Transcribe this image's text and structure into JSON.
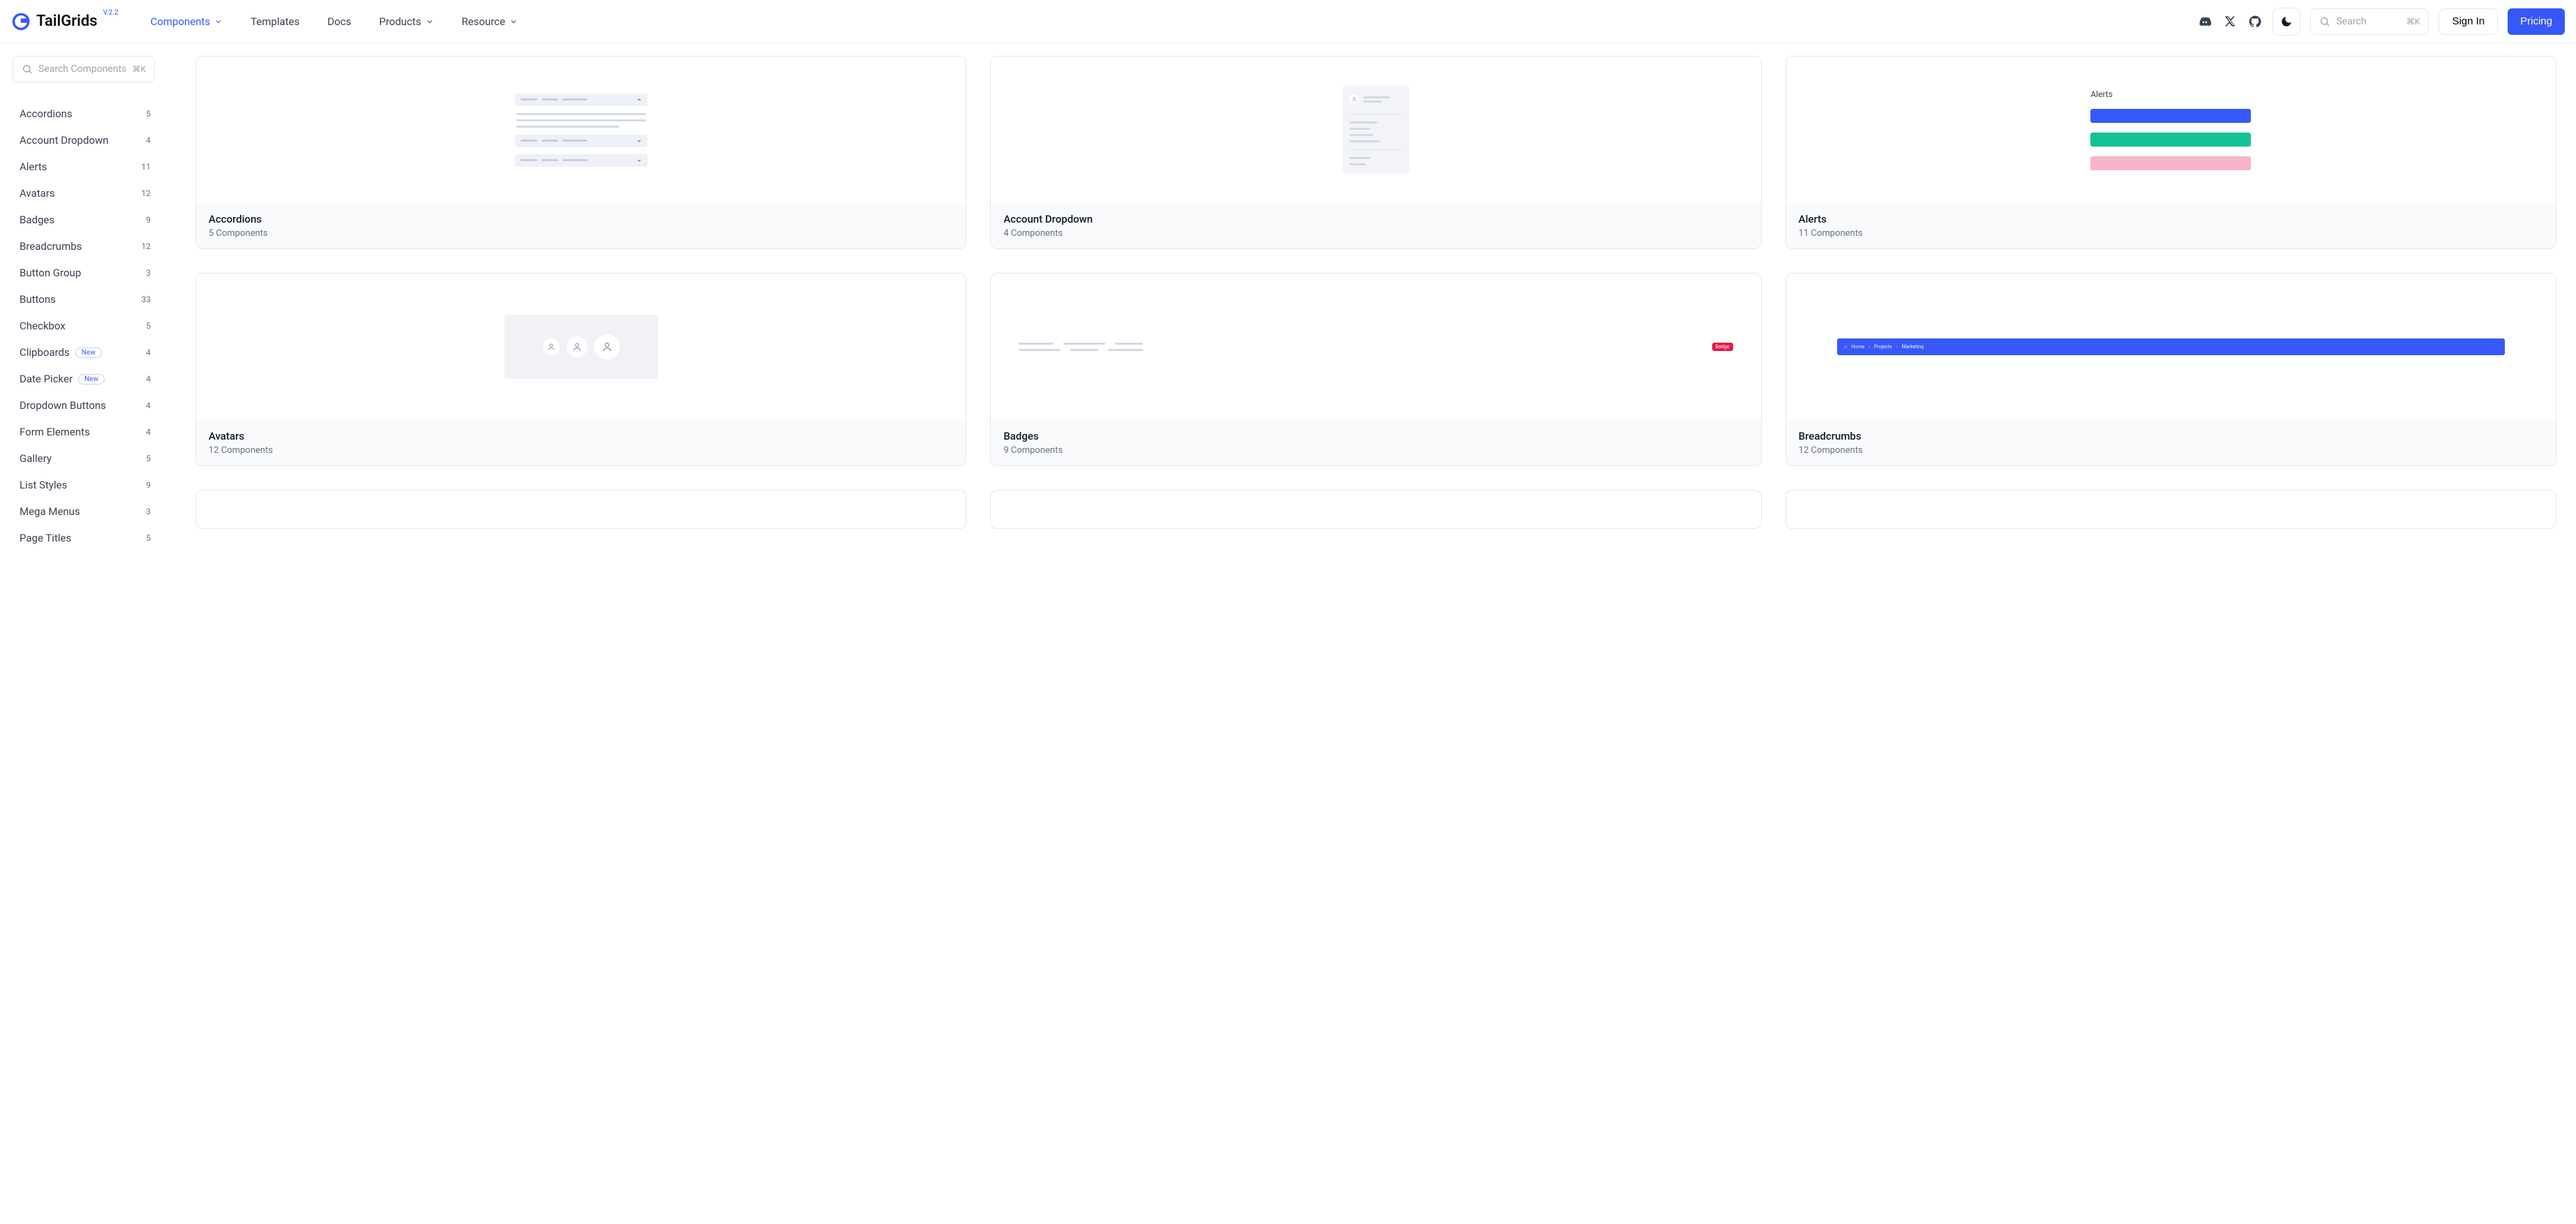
{
  "brand": {
    "name": "TailGrids",
    "version": "V.2.2"
  },
  "nav": [
    {
      "label": "Components",
      "dropdown": true,
      "active": true
    },
    {
      "label": "Templates",
      "dropdown": false,
      "active": false
    },
    {
      "label": "Docs",
      "dropdown": false,
      "active": false
    },
    {
      "label": "Products",
      "dropdown": true,
      "active": false
    },
    {
      "label": "Resource",
      "dropdown": true,
      "active": false
    }
  ],
  "top_search": {
    "placeholder": "Search",
    "kbd": "⌘K"
  },
  "auth": {
    "signin": "Sign In",
    "pricing": "Pricing"
  },
  "side_search": {
    "placeholder": "Search Components",
    "kbd": "⌘K"
  },
  "sidebar": [
    {
      "label": "Accordions",
      "count": "5",
      "new": false
    },
    {
      "label": "Account Dropdown",
      "count": "4",
      "new": false
    },
    {
      "label": "Alerts",
      "count": "11",
      "new": false
    },
    {
      "label": "Avatars",
      "count": "12",
      "new": false
    },
    {
      "label": "Badges",
      "count": "9",
      "new": false
    },
    {
      "label": "Breadcrumbs",
      "count": "12",
      "new": false
    },
    {
      "label": "Button Group",
      "count": "3",
      "new": false
    },
    {
      "label": "Buttons",
      "count": "33",
      "new": false
    },
    {
      "label": "Checkbox",
      "count": "5",
      "new": false
    },
    {
      "label": "Clipboards",
      "count": "4",
      "new": true
    },
    {
      "label": "Date Picker",
      "count": "4",
      "new": true
    },
    {
      "label": "Dropdown Buttons",
      "count": "4",
      "new": false
    },
    {
      "label": "Form Elements",
      "count": "4",
      "new": false
    },
    {
      "label": "Gallery",
      "count": "5",
      "new": false
    },
    {
      "label": "List Styles",
      "count": "9",
      "new": false
    },
    {
      "label": "Mega Menus",
      "count": "3",
      "new": false
    },
    {
      "label": "Page Titles",
      "count": "5",
      "new": false
    }
  ],
  "new_badge_text": "New",
  "cards": [
    {
      "title": "Accordions",
      "sub": "5 Components"
    },
    {
      "title": "Account Dropdown",
      "sub": "4 Components"
    },
    {
      "title": "Alerts",
      "sub": "11 Components"
    },
    {
      "title": "Avatars",
      "sub": "12 Components"
    },
    {
      "title": "Badges",
      "sub": "9 Components"
    },
    {
      "title": "Breadcrumbs",
      "sub": "12 Components"
    }
  ],
  "alerts_preview_label": "Alerts",
  "badge_preview_text": "Badge",
  "breadcrumb_preview": [
    "Home",
    "Projects",
    "Marketing"
  ],
  "home_icon": "⌂"
}
